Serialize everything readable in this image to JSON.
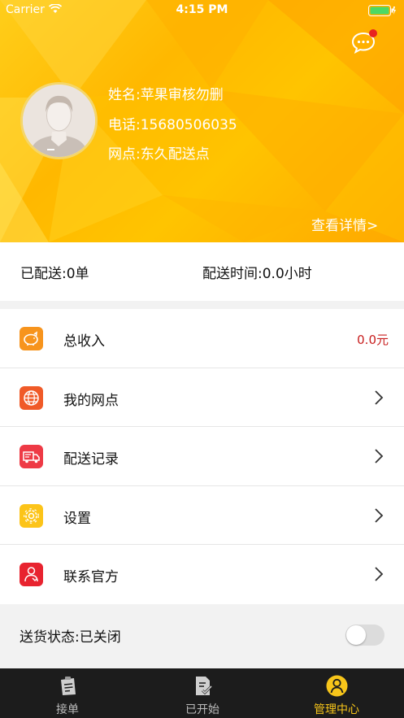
{
  "status_bar": {
    "carrier": "Carrier",
    "time": "4:15 PM"
  },
  "profile": {
    "name": "姓名:苹果审核勿删",
    "phone": "电话:15680506035",
    "station": "网点:东久配送点",
    "detail_link": "查看详情>"
  },
  "stats": {
    "delivered": "已配送:0单",
    "delivery_time": "配送时间:0.0小时"
  },
  "menu": [
    {
      "label": "总收入",
      "value": "0.0元",
      "icon": "piggy-bank-icon",
      "color": "#f7941d"
    },
    {
      "label": "我的网点",
      "icon": "globe-icon",
      "color": "#f05a28"
    },
    {
      "label": "配送记录",
      "icon": "truck-icon",
      "color": "#ee3a45"
    },
    {
      "label": "设置",
      "icon": "gear-icon",
      "color": "#fcc419"
    },
    {
      "label": "联系官方",
      "icon": "phone-contact-icon",
      "color": "#e8232f"
    }
  ],
  "delivery_status": {
    "label": "送货状态:已关闭",
    "enabled": false
  },
  "tabs": [
    {
      "label": "接单",
      "icon": "clipboard-icon",
      "active": false
    },
    {
      "label": "已开始",
      "icon": "document-check-icon",
      "active": false
    },
    {
      "label": "管理中心",
      "icon": "user-icon",
      "active": true
    }
  ],
  "colors": {
    "accent": "#f7c51a",
    "header": "#ffb800",
    "value_red": "#c81e1e",
    "tab_bar": "#1c1c1c"
  }
}
